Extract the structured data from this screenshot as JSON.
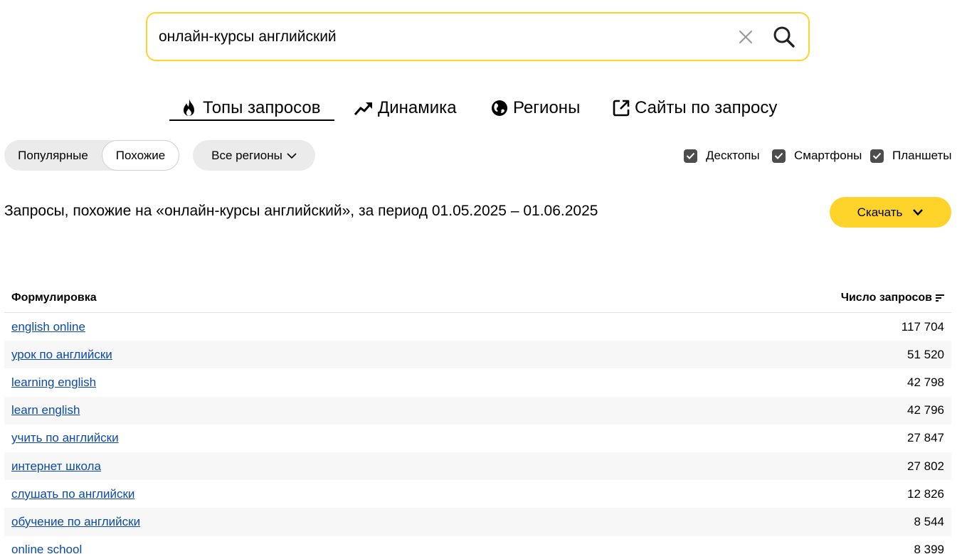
{
  "search": {
    "value": "онлайн-курсы английский",
    "clear_icon": "close-icon",
    "search_icon": "search-icon"
  },
  "tabs": [
    {
      "label": "Топы запросов",
      "icon": "fire-icon",
      "active": true
    },
    {
      "label": "Динамика",
      "icon": "trend-icon",
      "active": false
    },
    {
      "label": "Регионы",
      "icon": "globe-icon",
      "active": false
    },
    {
      "label": "Сайты по запросу",
      "icon": "external-link-icon",
      "active": false
    }
  ],
  "filters": {
    "segment": {
      "popular": "Популярные",
      "similar": "Похожие",
      "selected": "similar"
    },
    "region": "Все регионы",
    "devices": [
      {
        "label": "Десктопы",
        "checked": true
      },
      {
        "label": "Смартфоны",
        "checked": true
      },
      {
        "label": "Планшеты",
        "checked": true
      }
    ]
  },
  "heading": "Запросы, похожие на «онлайн-курсы английский», за период 01.05.2025 – 01.06.2025",
  "download_label": "Скачать",
  "table": {
    "columns": [
      "Формулировка",
      "Число запросов"
    ],
    "rows": [
      {
        "phrase": "english online",
        "count": "117 704"
      },
      {
        "phrase": "урок по английски",
        "count": "51 520"
      },
      {
        "phrase": "learning english",
        "count": "42 798"
      },
      {
        "phrase": "learn english",
        "count": "42 796"
      },
      {
        "phrase": "учить по английски",
        "count": "27 847"
      },
      {
        "phrase": "интернет школа",
        "count": "27 802"
      },
      {
        "phrase": "слушать по английски",
        "count": "12 826"
      },
      {
        "phrase": "обучение по английски",
        "count": "8 544"
      },
      {
        "phrase": "online school",
        "count": "8 399"
      }
    ]
  },
  "colors": {
    "accent": "#fed42b",
    "link": "#0b4aa8",
    "checkbox": "#4d4d4d"
  }
}
